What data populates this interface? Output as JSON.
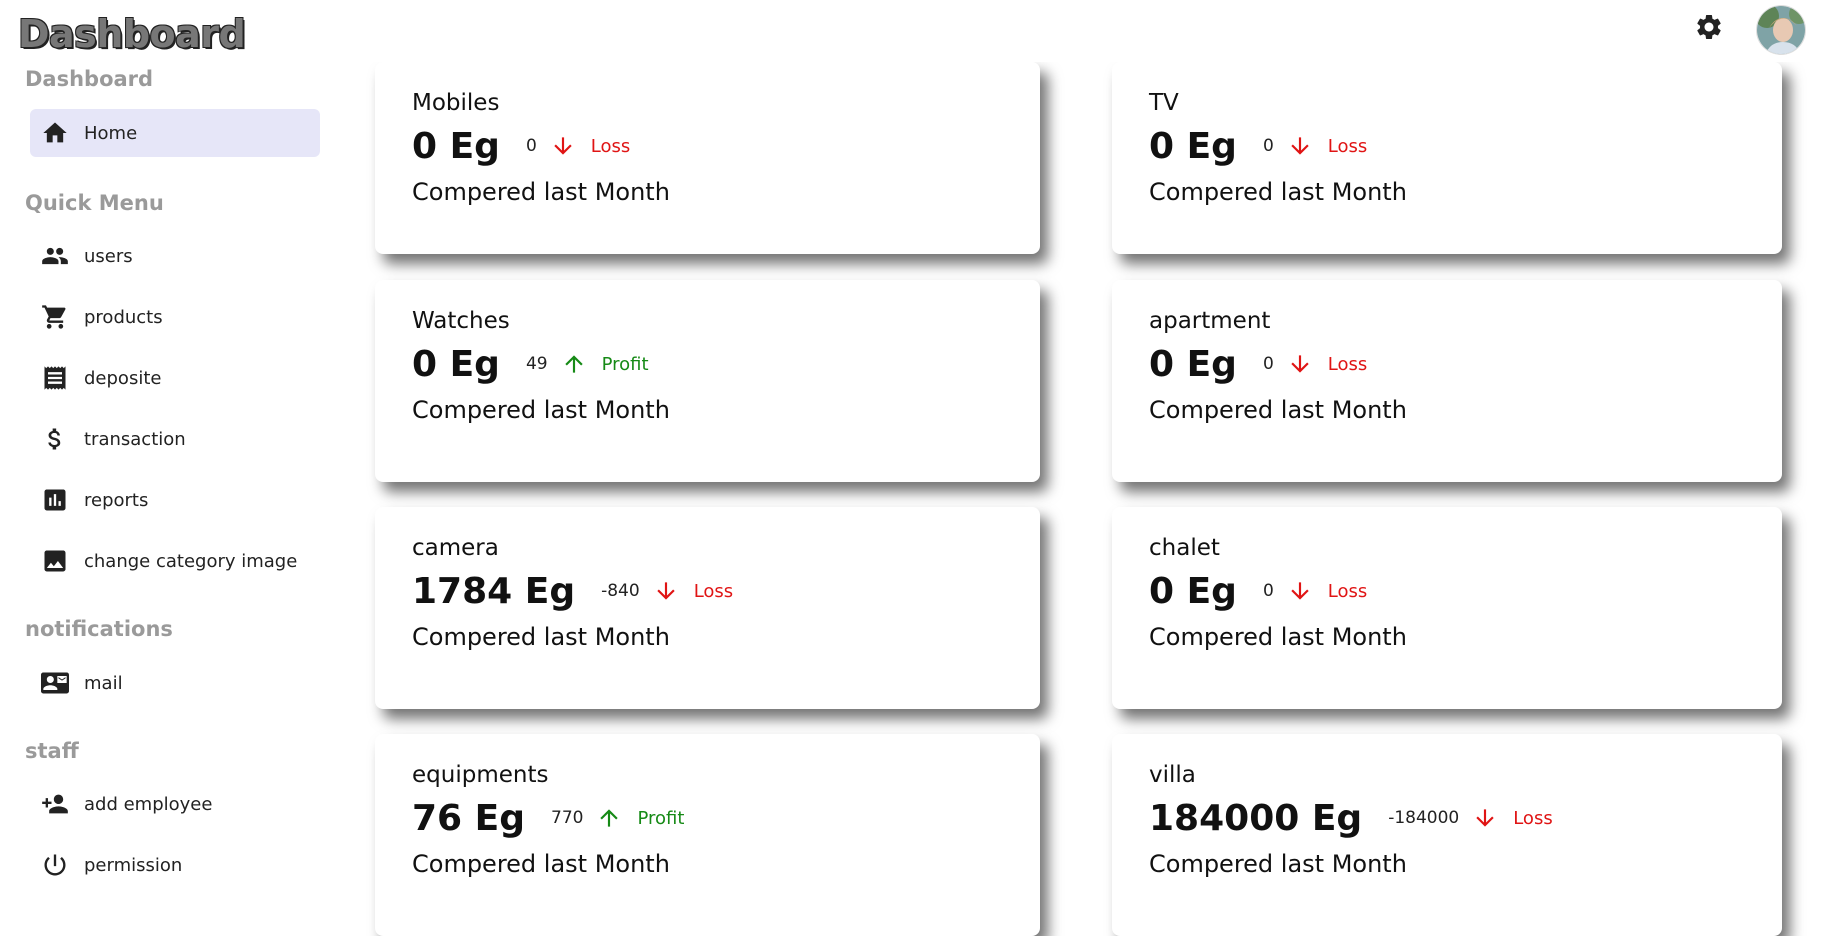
{
  "header": {
    "logo": "Dashboard"
  },
  "sidebar": {
    "sections": {
      "dashboard": "Dashboard",
      "quick_menu": "Quick Menu",
      "notifications": "notifications",
      "staff": "staff"
    },
    "items": {
      "home": "Home",
      "users": "users",
      "products": "products",
      "deposite": "deposite",
      "transaction": "transaction",
      "reports": "reports",
      "change_category_image": "change category image",
      "mail": "mail",
      "add_employee": "add employee",
      "permission": "permission"
    }
  },
  "cards": [
    {
      "title": "Mobiles",
      "amount": "0 Eg",
      "diff": "0",
      "status": "Loss",
      "trend": "down",
      "sub": "Compered last Month"
    },
    {
      "title": "TV",
      "amount": "0 Eg",
      "diff": "0",
      "status": "Loss",
      "trend": "down",
      "sub": "Compered last Month"
    },
    {
      "title": "Watches",
      "amount": "0 Eg",
      "diff": "49",
      "status": "Profit",
      "trend": "up",
      "sub": "Compered last Month"
    },
    {
      "title": "apartment",
      "amount": "0 Eg",
      "diff": "0",
      "status": "Loss",
      "trend": "down",
      "sub": "Compered last Month"
    },
    {
      "title": "camera",
      "amount": "1784 Eg",
      "diff": "-840",
      "status": "Loss",
      "trend": "down",
      "sub": "Compered last Month"
    },
    {
      "title": "chalet",
      "amount": "0 Eg",
      "diff": "0",
      "status": "Loss",
      "trend": "down",
      "sub": "Compered last Month"
    },
    {
      "title": "equipments",
      "amount": "76 Eg",
      "diff": "770",
      "status": "Profit",
      "trend": "up",
      "sub": "Compered last Month"
    },
    {
      "title": "villa",
      "amount": "184000 Eg",
      "diff": "-184000",
      "status": "Loss",
      "trend": "down",
      "sub": "Compered last Month"
    }
  ],
  "colors": {
    "loss": "#e01414",
    "profit": "#168a16",
    "active_nav": "#e6e6f8",
    "section_title": "#9a9a9a"
  }
}
